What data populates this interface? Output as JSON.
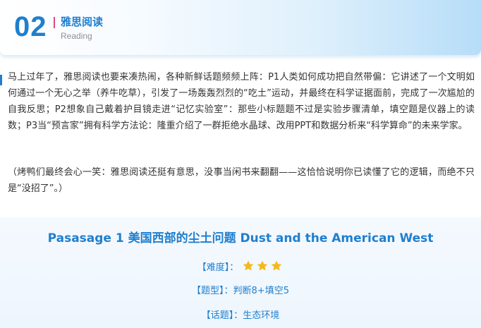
{
  "header": {
    "number": "02",
    "title": "雅思阅读",
    "subtitle": "Reading"
  },
  "intro": {
    "paragraph1": "马上过年了，雅思阅读也要来凑热闹，各种新鲜话题频频上阵：P1人类如何成功把自然带偏：它讲述了一个文明如何通过一个无心之举（养牛吃草），引发了一场轰轰烈烈的“吃土”运动，并最终在科学证据面前，完成了一次尴尬的自我反思；P2想象自己戴着护目镜走进“记忆实验室”：那些小标题题不过是实验步骤清单，填空题是仪器上的读数；P3当“预言家”拥有科学方法论：隆重介绍了一群拒绝水晶球、改用PPT和数据分析来“科学算命”的未来学家。",
    "paragraph2": "（烤鸭们最终会心一笑：雅思阅读还挺有意思，没事当闲书来翻翻——这恰恰说明你已读懂了它的逻辑，而绝不只是“没招了”。）"
  },
  "passage": {
    "title": "Pasasage 1  美国西部的尘土问题 Dust and the American West",
    "difficulty_label": "【难度】：",
    "difficulty_stars": 3,
    "type_label": "【题型】：",
    "type_value": "判断8+填空5",
    "topic_label": "【话题】：",
    "topic_value": "生态环境"
  },
  "colors": {
    "accent": "#1f7fce",
    "separator": "#e2477e",
    "star": "#f5b81c",
    "body_text": "#333333"
  }
}
